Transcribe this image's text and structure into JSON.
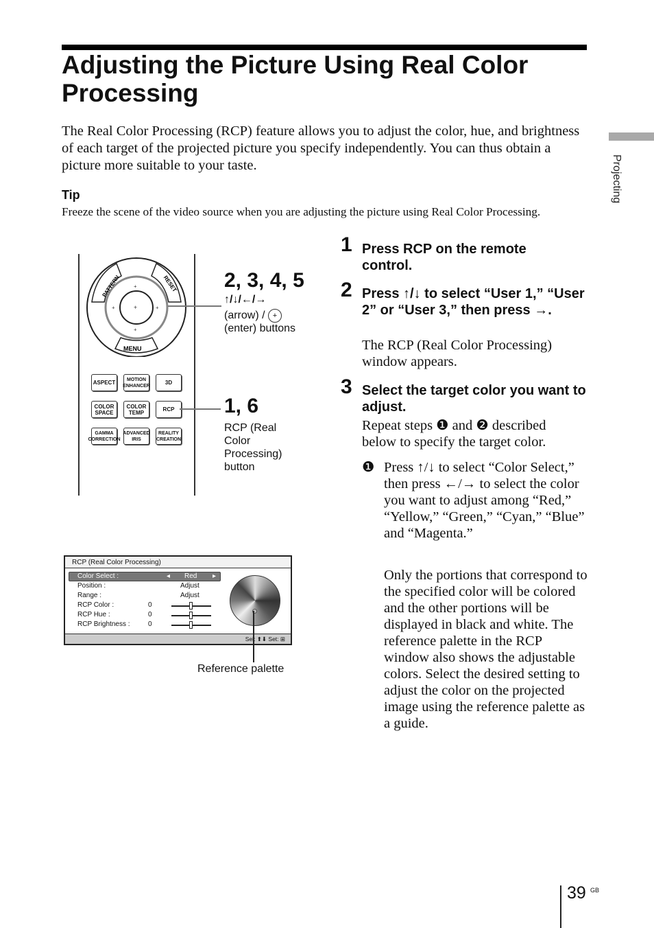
{
  "title": "Adjusting the Picture Using Real Color Processing",
  "intro": "The Real Color Processing (RCP) feature allows you to adjust the color, hue, and brightness of each target of the projected picture you specify independently. You can thus obtain a picture more suitable to your taste.",
  "tip": {
    "heading": "Tip",
    "body": "Freeze the scene of the video source when you are adjusting the picture using Real Color Processing."
  },
  "side_tab": "Projecting",
  "remote": {
    "ring": {
      "pattern": "PATTERN",
      "reset": "RESET",
      "menu": "MENU"
    },
    "buttons": [
      "ASPECT",
      "MOTION ENHANCER",
      "3D",
      "COLOR SPACE",
      "COLOR TEMP",
      "RCP",
      "GAMMA CORRECTION",
      "ADVANCED IRIS",
      "REALITY CREATION"
    ],
    "callout1": {
      "steps": "2, 3, 4, 5",
      "arrows": "↑/↓/←/→",
      "line1": "(arrow) /",
      "line2": "(enter) buttons"
    },
    "callout2": {
      "steps": "1, 6",
      "text": "RCP (Real Color Processing) button"
    }
  },
  "osd": {
    "title": "RCP (Real Color Processing)",
    "rows": [
      {
        "label": "Color Select :",
        "value": "Red"
      },
      {
        "label": "Position :",
        "value": "Adjust"
      },
      {
        "label": "Range :",
        "value": "Adjust"
      },
      {
        "label": "RCP Color :",
        "value": "0"
      },
      {
        "label": "RCP Hue :",
        "value": "0"
      },
      {
        "label": "RCP Brightness :",
        "value": "0"
      }
    ],
    "footer": "Sel: ⬆⬇  Set: ⊞",
    "caption": "Reference palette"
  },
  "steps": [
    {
      "num": "1",
      "heading": "Press RCP on the remote control."
    },
    {
      "num": "2",
      "heading": "Press ↑/↓ to select “User 1,” “User 2” or “User 3,” then press →.",
      "body": "The RCP (Real Color Processing) window appears."
    },
    {
      "num": "3",
      "heading": "Select the target color you want to adjust.",
      "body": "Repeat steps ❶ and ❷ described below to specify the target color.",
      "substep_marker": "❶",
      "substep": "Press ↑/↓ to select “Color Select,” then press ←/→ to select the color you want to adjust among “Red,” “Yellow,” “Green,” “Cyan,” “Blue” and “Magenta.”",
      "note": "Only the portions that correspond to the specified color will be colored and the other portions will be displayed in black and white. The reference palette in the RCP window also shows the adjustable colors. Select the desired setting to adjust the color on the projected image using the reference palette as a guide."
    }
  ],
  "page": {
    "number": "39",
    "suffix": "GB"
  }
}
